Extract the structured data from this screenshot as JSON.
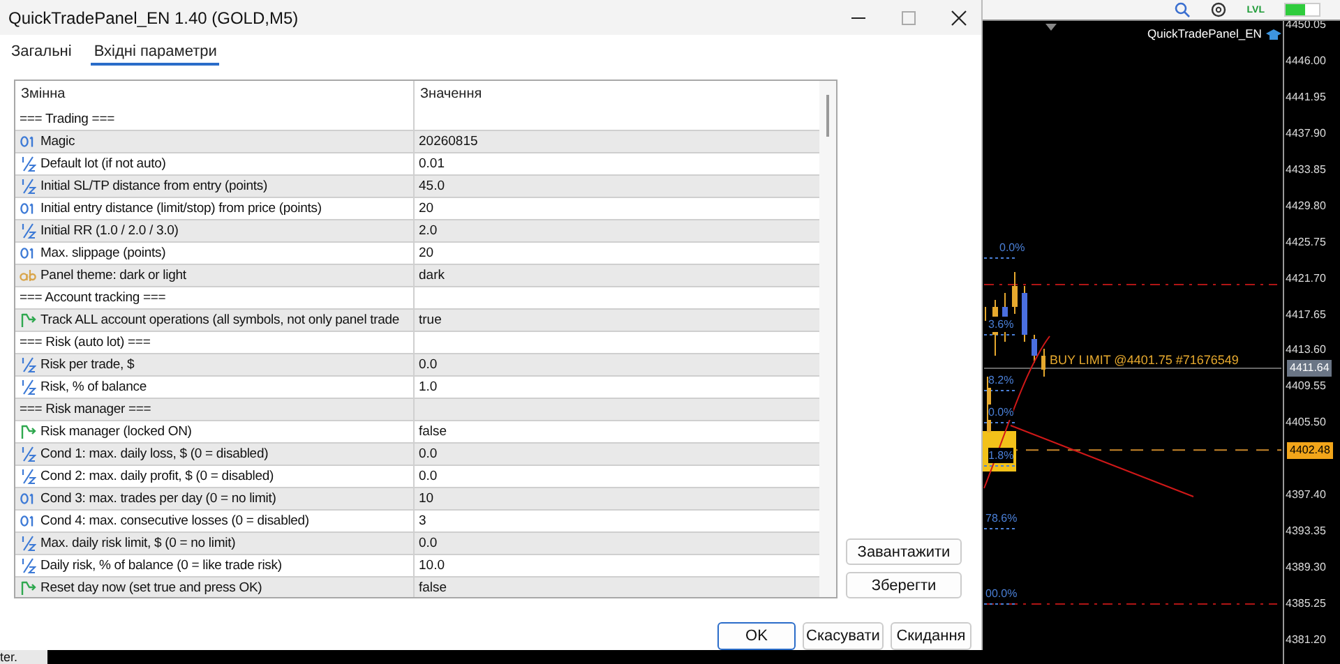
{
  "window": {
    "title": "QuickTradePanel_EN 1.40 (GOLD,M5)"
  },
  "tabs": [
    {
      "label": "Загальні",
      "selected": false
    },
    {
      "label": "Вхідні параметри",
      "selected": true
    }
  ],
  "table": {
    "columns": [
      "Змінна",
      "Значення"
    ],
    "rows": [
      {
        "kind": "section",
        "name": "=== Trading ==="
      },
      {
        "kind": "int",
        "name": "Magic",
        "value": "20260815"
      },
      {
        "kind": "double",
        "name": "Default lot (if not auto)",
        "value": "0.01"
      },
      {
        "kind": "double",
        "name": "Initial SL/TP distance from entry (points)",
        "value": "45.0"
      },
      {
        "kind": "int",
        "name": "Initial entry distance (limit/stop) from price (points)",
        "value": "20"
      },
      {
        "kind": "double",
        "name": "Initial RR (1.0 / 2.0 / 3.0)",
        "value": "2.0"
      },
      {
        "kind": "int",
        "name": "Max. slippage (points)",
        "value": "20"
      },
      {
        "kind": "string",
        "name": "Panel theme: dark or light",
        "value": "dark"
      },
      {
        "kind": "section",
        "name": "=== Account tracking ==="
      },
      {
        "kind": "bool",
        "name": "Track ALL account operations (all symbols, not only panel trade",
        "value": "true"
      },
      {
        "kind": "section",
        "name": "=== Risk (auto lot) ==="
      },
      {
        "kind": "double",
        "name": "Risk per trade, $",
        "value": "0.0"
      },
      {
        "kind": "double",
        "name": "Risk, % of balance",
        "value": "1.0"
      },
      {
        "kind": "section",
        "name": "=== Risk manager ==="
      },
      {
        "kind": "bool",
        "name": "Risk manager (locked ON)",
        "value": "false"
      },
      {
        "kind": "double",
        "name": "Cond 1: max. daily loss, $ (0 = disabled)",
        "value": "0.0"
      },
      {
        "kind": "double",
        "name": "Cond 2: max. daily profit, $ (0 = disabled)",
        "value": "0.0"
      },
      {
        "kind": "int",
        "name": "Cond 3: max. trades per day (0 = no limit)",
        "value": "10"
      },
      {
        "kind": "int",
        "name": "Cond 4: max. consecutive losses (0 = disabled)",
        "value": "3"
      },
      {
        "kind": "double",
        "name": "Max. daily risk limit, $ (0 = no limit)",
        "value": "0.0"
      },
      {
        "kind": "double",
        "name": "Daily risk, % of balance (0 = like trade risk)",
        "value": "10.0"
      },
      {
        "kind": "bool",
        "name": "Reset day now (set true and press OK)",
        "value": "false"
      }
    ]
  },
  "side_buttons": [
    "Завантажити",
    "Зберегти"
  ],
  "buttons": [
    {
      "label": "OK",
      "default": true
    },
    {
      "label": "Скасувати",
      "default": false
    },
    {
      "label": "Скидання",
      "default": false
    }
  ],
  "status_bar": {
    "text": "ter."
  },
  "toolbar": {
    "label": "LVL",
    "level": 0.6
  },
  "chart": {
    "indicator": "QuickTradePanel_EN",
    "price_axis": [
      "4450.05",
      "4446.00",
      "4441.95",
      "4437.90",
      "4433.85",
      "4429.80",
      "4425.75",
      "4421.70",
      "4417.65",
      "4413.60",
      "4409.55",
      "4405.50",
      "4397.40",
      "4393.35",
      "4389.30",
      "4385.25",
      "4381.20"
    ],
    "current_price": "4411.64",
    "order_price": "4402.48",
    "order_label": "BUY LIMIT @4401.75 #71676549",
    "fib_labels": [
      "0.0%",
      "3.6%",
      "8.2%",
      "0.0%",
      "1.8%",
      "78.6%",
      "00.0%"
    ]
  }
}
